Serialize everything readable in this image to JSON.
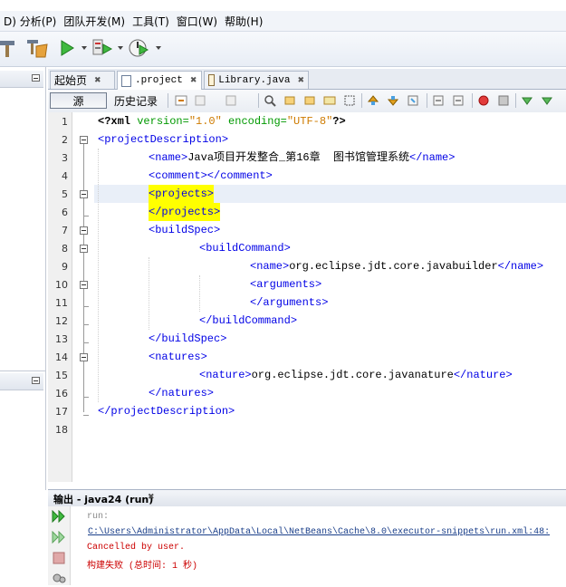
{
  "menu": [
    "D) 分析(P)",
    "团队开发(M)",
    "工具(T)",
    "窗口(W)",
    "帮助(H)"
  ],
  "tabs": [
    {
      "label": "起始页",
      "close": "✖"
    },
    {
      "label": ".project",
      "close": "✖"
    },
    {
      "label": "Library.java",
      "close": "✖"
    }
  ],
  "editor_toolbar": {
    "source": "源",
    "history": "历史记录"
  },
  "code_lines": [
    {
      "n": "1"
    },
    {
      "n": "2"
    },
    {
      "n": "3"
    },
    {
      "n": "4"
    },
    {
      "n": "5"
    },
    {
      "n": "6"
    },
    {
      "n": "7"
    },
    {
      "n": "8"
    },
    {
      "n": "9"
    },
    {
      "n": "10"
    },
    {
      "n": "11"
    },
    {
      "n": "12"
    },
    {
      "n": "13"
    },
    {
      "n": "14"
    },
    {
      "n": "15"
    },
    {
      "n": "16"
    },
    {
      "n": "17"
    },
    {
      "n": "18"
    }
  ],
  "code": {
    "l1_a": "<?xml",
    "l1_b": " version=",
    "l1_c": "\"1.0\"",
    "l1_d": " encoding=",
    "l1_e": "\"UTF-8\"",
    "l1_f": "?>",
    "l2": "<projectDescription>",
    "l3_open": "<name>",
    "l3_text": "Java项目开发整合_第16章  图书馆管理系统",
    "l3_close": "</name>",
    "l4": "<comment></comment>",
    "l5": "<projects>",
    "l6": "</projects>",
    "l7": "<buildSpec>",
    "l8": "<buildCommand>",
    "l9_open": "<name>",
    "l9_text": "org.eclipse.jdt.core.javabuilder",
    "l9_close": "</name>",
    "l10": "<arguments>",
    "l11": "</arguments>",
    "l12": "</buildCommand>",
    "l13": "</buildSpec>",
    "l14": "<natures>",
    "l15_open": "<nature>",
    "l15_text": "org.eclipse.jdt.core.javanature",
    "l15_close": "</nature>",
    "l16": "</natures>",
    "l17": "</projectDescription>"
  },
  "output": {
    "title": "输出 - java24 (run)",
    "close": "✖",
    "lines": {
      "run": "run:",
      "path": "C:\\Users\\Administrator\\AppData\\Local\\NetBeans\\Cache\\8.0\\executor-snippets\\run.xml:48:",
      "cancelled": "Cancelled by user.",
      "failed": "构建失败 (总时间: 1 秒)"
    }
  },
  "colors": {
    "tag": "#0000e6",
    "attr": "#009900",
    "string": "#ce7b00",
    "error": "#cc0000",
    "highlight": "#ffff00"
  }
}
